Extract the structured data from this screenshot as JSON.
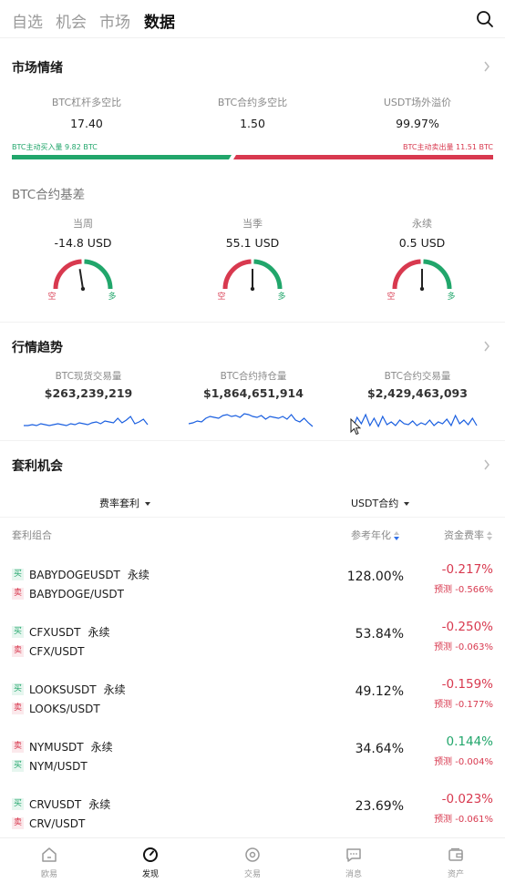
{
  "top_tabs": [
    "自选",
    "机会",
    "市场",
    "数据"
  ],
  "active_tab": "数据",
  "market_sentiment": {
    "title": "市场情绪",
    "stats": [
      {
        "label": "BTC杠杆多空比",
        "value": "17.40"
      },
      {
        "label": "BTC合约多空比",
        "value": "1.50"
      },
      {
        "label": "USDT场外溢价",
        "value": "99.97%"
      }
    ],
    "buy_flow": "BTC主动买入量 9.82 BTC",
    "sell_flow": "BTC主动卖出量 11.51 BTC",
    "buy_share": 0.46,
    "buy_color": "#21a66b",
    "sell_color": "#d8394f"
  },
  "basis": {
    "title": "BTC合约基差",
    "gauges": [
      {
        "label": "当周",
        "value": "-14.8 USD",
        "left": "空",
        "right": "多",
        "level": 0.45
      },
      {
        "label": "当季",
        "value": "55.1 USD",
        "left": "空",
        "right": "多",
        "level": 0.5
      },
      {
        "label": "永续",
        "value": "0.5 USD",
        "left": "空",
        "right": "多",
        "level": 0.5
      }
    ]
  },
  "trend": {
    "title": "行情趋势",
    "cols": [
      {
        "label": "BTC现货交易量",
        "value": "$263,239,219"
      },
      {
        "label": "BTC合约持仓量",
        "value": "$1,864,651,914"
      },
      {
        "label": "BTC合约交易量",
        "value": "$2,429,463,093"
      }
    ],
    "line_color": "#1a5fe0"
  },
  "arbitrage": {
    "title": "套利机会",
    "filter_type": "费率套利",
    "filter_contract": "USDT合约",
    "headers": {
      "combo": "套利组合",
      "annual": "参考年化",
      "rate": "资金费率"
    },
    "predict_label": "预测",
    "perp_label": "永续",
    "rows": [
      {
        "leg1_tag": "买",
        "leg1": "BABYDOGEUSDT",
        "leg2_tag": "卖",
        "leg2": "BABYDOGE/USDT",
        "annual": "128.00%",
        "rate": "-0.217%",
        "predict": "-0.566%"
      },
      {
        "leg1_tag": "买",
        "leg1": "CFXUSDT",
        "leg2_tag": "卖",
        "leg2": "CFX/USDT",
        "annual": "53.84%",
        "rate": "-0.250%",
        "predict": "-0.063%"
      },
      {
        "leg1_tag": "买",
        "leg1": "LOOKSUSDT",
        "leg2_tag": "卖",
        "leg2": "LOOKS/USDT",
        "annual": "49.12%",
        "rate": "-0.159%",
        "predict": "-0.177%"
      },
      {
        "leg1_tag": "卖",
        "leg1": "NYMUSDT",
        "leg2_tag": "买",
        "leg2": "NYM/USDT",
        "annual": "34.64%",
        "rate": "0.144%",
        "predict": "-0.004%"
      },
      {
        "leg1_tag": "买",
        "leg1": "CRVUSDT",
        "leg2_tag": "卖",
        "leg2": "CRV/USDT",
        "annual": "23.69%",
        "rate": "-0.023%",
        "predict": "-0.061%"
      }
    ]
  },
  "bottom_nav": [
    {
      "label": "欧易",
      "icon": "home-icon"
    },
    {
      "label": "发现",
      "icon": "discover-icon"
    },
    {
      "label": "交易",
      "icon": "trade-icon"
    },
    {
      "label": "消息",
      "icon": "message-icon"
    },
    {
      "label": "资产",
      "icon": "wallet-icon"
    }
  ],
  "active_nav": "发现"
}
